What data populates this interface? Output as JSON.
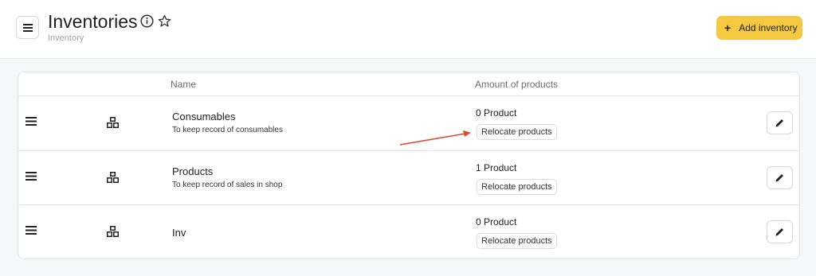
{
  "header": {
    "title": "Inventories",
    "subtitle": "Inventory",
    "menu_icon": "hamburger-icon",
    "info_icon": "info-icon",
    "star_icon": "star-icon",
    "add_button": {
      "plus": "+",
      "label": "Add inventory",
      "color": "#f5c842"
    }
  },
  "table": {
    "columns": [
      "Name",
      "Amount of products"
    ],
    "rows": [
      {
        "name": "Consumables",
        "description": "To keep record of consumables",
        "amount": "0 Product",
        "relocate_label": "Relocate products"
      },
      {
        "name": "Products",
        "description": "To keep record of sales in shop",
        "amount": "1 Product",
        "relocate_label": "Relocate products"
      },
      {
        "name": "Inv",
        "description": "",
        "amount": "0 Product",
        "relocate_label": "Relocate products"
      }
    ]
  },
  "annotation": {
    "type": "arrow",
    "color": "#e0492f"
  }
}
